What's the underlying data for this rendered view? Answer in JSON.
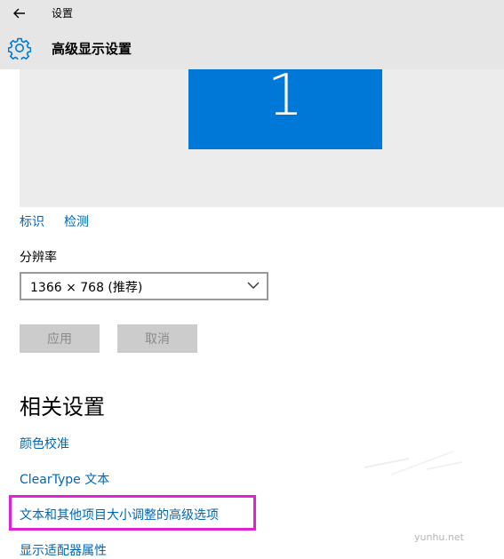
{
  "window": {
    "app_title": "设置",
    "page_title": "高级显示设置"
  },
  "icons": {
    "back": "back-arrow-icon",
    "settings": "gear-icon",
    "dropdown": "chevron-down-icon"
  },
  "colors": {
    "accent": "#0078d7",
    "link": "#0066b4",
    "titlebar": "#e6e6e6",
    "preview_bg": "#ececec",
    "disabled_button": "#cccccc",
    "highlight": "#e021d6"
  },
  "display_preview": {
    "monitor_number": "1"
  },
  "display_actions": {
    "identify": "标识",
    "detect": "检测"
  },
  "resolution": {
    "label": "分辨率",
    "selected": "1366 × 768 (推荐)"
  },
  "buttons": {
    "apply": "应用",
    "cancel": "取消"
  },
  "related": {
    "title": "相关设置",
    "links": [
      "颜色校准",
      "ClearType 文本",
      "文本和其他项目大小调整的高级选项",
      "显示适配器属性"
    ]
  },
  "watermark": "yunhu.net"
}
